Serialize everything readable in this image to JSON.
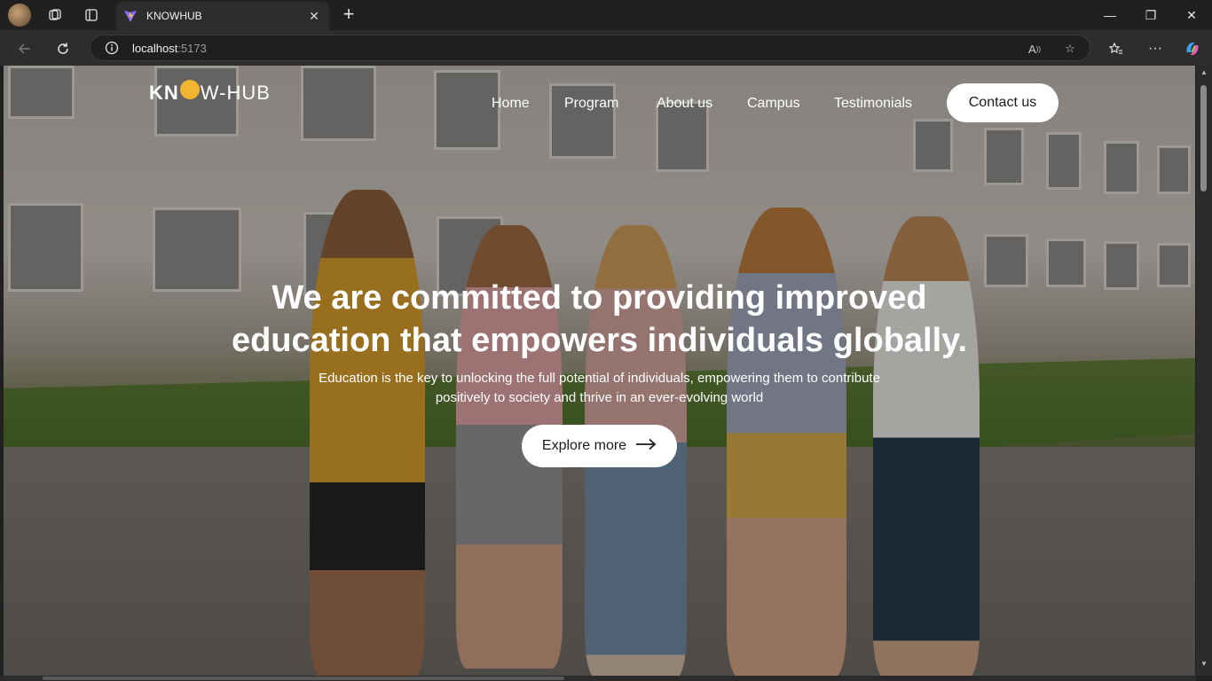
{
  "browser": {
    "tab_title": "KNOWHUB",
    "url_host": "localhost",
    "url_port": ":5173",
    "icons": [
      "profile-avatar",
      "workspaces-icon",
      "tab-actions-icon",
      "vite-favicon",
      "close-icon",
      "plus-icon",
      "minimize-icon",
      "restore-icon",
      "close-window-icon",
      "back-icon",
      "refresh-icon",
      "info-icon",
      "read-aloud-icon",
      "favorite-star-icon",
      "favorites-icon",
      "more-icon",
      "copilot-icon"
    ]
  },
  "site": {
    "logo_text_1": "KN",
    "logo_text_2": "W-HUB",
    "nav": [
      "Home",
      "Program",
      "About us",
      "Campus",
      "Testimonials"
    ],
    "contact_label": "Contact us",
    "headline_line1": "We are committed to providing improved",
    "headline_line2": "education that empowers individuals globally.",
    "sub_line1": "Education is the key to unlocking the full potential of individuals, empowering them to contribute",
    "sub_line2": "positively to society and thrive in an ever-evolving world",
    "explore_label": "Explore more",
    "accent": "#f2b531"
  }
}
